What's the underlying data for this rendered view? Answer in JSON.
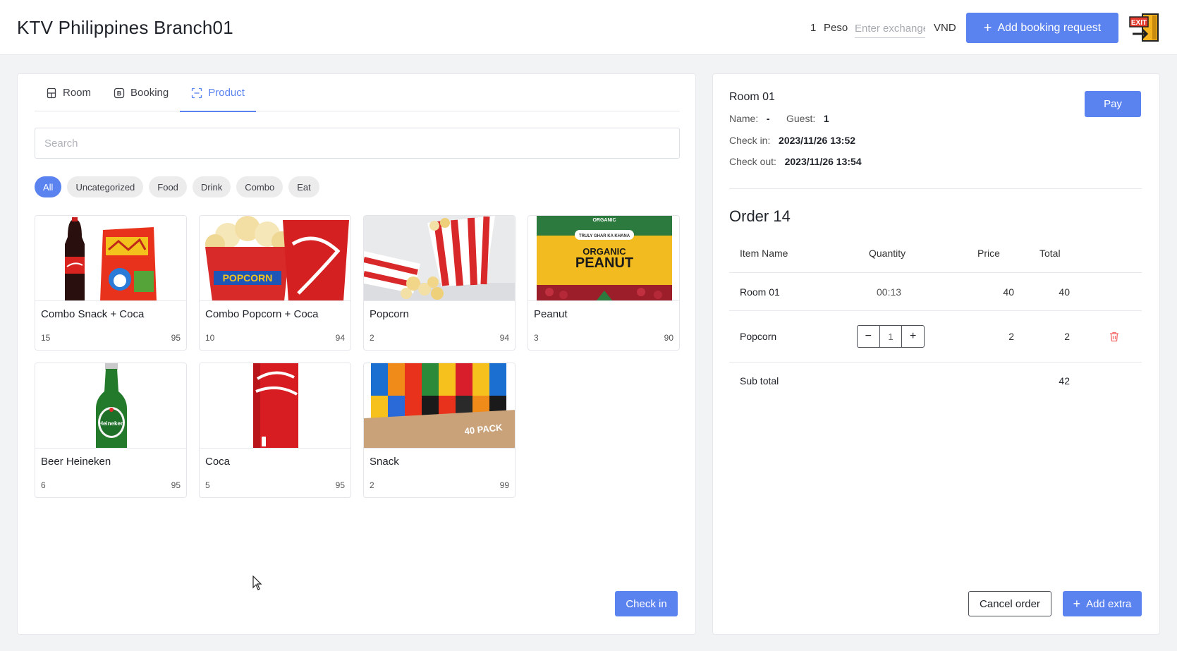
{
  "header": {
    "title": "KTV Philippines Branch01",
    "rate_amount": "1",
    "rate_currency": "Peso",
    "rate_placeholder": "Enter exchange rate",
    "target_currency": "VND",
    "add_booking_label": "Add booking request",
    "exit_label": "EXIT"
  },
  "tabs": [
    {
      "label": "Room",
      "icon": "room-icon",
      "active": false
    },
    {
      "label": "Booking",
      "icon": "booking-icon",
      "active": false
    },
    {
      "label": "Product",
      "icon": "product-icon",
      "active": true
    }
  ],
  "search": {
    "placeholder": "Search",
    "value": ""
  },
  "categories": [
    {
      "label": "All",
      "active": true
    },
    {
      "label": "Uncategorized",
      "active": false
    },
    {
      "label": "Food",
      "active": false
    },
    {
      "label": "Drink",
      "active": false
    },
    {
      "label": "Combo",
      "active": false
    },
    {
      "label": "Eat",
      "active": false
    }
  ],
  "products": [
    {
      "name": "Combo Snack + Coca",
      "stock": "15",
      "price": "95",
      "image": "combo-snack-coca-image"
    },
    {
      "name": "Combo Popcorn + Coca",
      "stock": "10",
      "price": "94",
      "image": "combo-popcorn-coca-image"
    },
    {
      "name": "Popcorn",
      "stock": "2",
      "price": "94",
      "image": "popcorn-image"
    },
    {
      "name": "Peanut",
      "stock": "3",
      "price": "90",
      "image": "peanut-image",
      "image_text": [
        "ORGANIC",
        "TRULY GHAR KA KHANA",
        "ORGANIC",
        "PEANUT"
      ]
    },
    {
      "name": "Beer Heineken",
      "stock": "6",
      "price": "95",
      "image": "heineken-image",
      "image_text": [
        "Heineken"
      ]
    },
    {
      "name": "Coca",
      "stock": "5",
      "price": "95",
      "image": "coca-image"
    },
    {
      "name": "Snack",
      "stock": "2",
      "price": "99",
      "image": "snack-box-image",
      "image_text": [
        "40 PACK"
      ]
    }
  ],
  "checkin_label": "Check in",
  "room": {
    "title": "Room 01",
    "name_label": "Name:",
    "name_value": "-",
    "guest_label": "Guest:",
    "guest_value": "1",
    "checkin_label": "Check in:",
    "checkin_value": "2023/11/26 13:52",
    "checkout_label": "Check out:",
    "checkout_value": "2023/11/26 13:54",
    "pay_label": "Pay"
  },
  "order": {
    "title": "Order 14",
    "columns": [
      "Item Name",
      "Quantity",
      "Price",
      "Total"
    ],
    "items": [
      {
        "name": "Room 01",
        "quantity": "00:13",
        "price": "40",
        "total": "40"
      },
      {
        "name": "Popcorn",
        "quantity": "1",
        "price": "2",
        "total": "2"
      }
    ],
    "subtotal_label": "Sub total",
    "subtotal_value": "42",
    "cancel_label": "Cancel order",
    "add_extra_label": "Add extra"
  },
  "colors": {
    "accent": "#5b83f0",
    "danger": "#f56c6c",
    "chip_bg": "#ececec"
  }
}
